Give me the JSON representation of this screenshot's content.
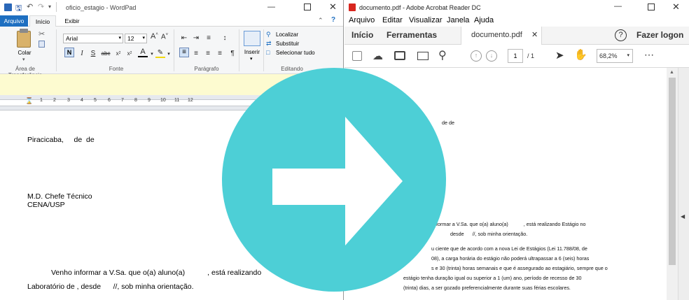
{
  "wordpad": {
    "title": "oficio_estagio - WordPad",
    "tabs": [
      "Arquivo",
      "Início",
      "Exibir"
    ],
    "clipboard": {
      "paste_label": "Colar",
      "group_label": "Área de Transferência"
    },
    "font": {
      "name": "Arial",
      "size": "12",
      "group_label": "Fonte"
    },
    "paragraph": {
      "group_label": "Parágrafo"
    },
    "insert": {
      "label": "Inserir"
    },
    "editing": {
      "find": "Localizar",
      "replace": "Substituir",
      "select_all": "Selecionar tudo",
      "group_label": "Editando"
    },
    "ruler": [
      "1",
      "2",
      "3",
      "4",
      "5",
      "6",
      "7",
      "8",
      "9",
      "10",
      "11",
      "12"
    ],
    "doc": {
      "city_line": "Piracicaba,     de  de",
      "recipient_line1": "M.D. Chefe Técnico",
      "recipient_line2": "CENA/USP",
      "body_line1": "Venho informar a V.Sa. que o(a) aluno(a)           , está realizando",
      "body_line2": "Laboratório de , desde      //, sob minha orientação."
    }
  },
  "acrobat": {
    "title": "documento.pdf - Adobe Acrobat Reader DC",
    "menu": [
      "Arquivo",
      "Editar",
      "Visualizar",
      "Janela",
      "Ajuda"
    ],
    "tabs": {
      "home": "Início",
      "tools": "Ferramentas",
      "doc": "documento.pdf"
    },
    "help": "?",
    "login": "Fazer logon",
    "page_current": "1",
    "page_total": "/ 1",
    "zoom": "68,2%",
    "pdf_text": {
      "line_date": "de  de",
      "p1_a": "formar a V.Sa. que o(a) aluno(a)           , está realizando Estágio no",
      "p1_b": "desde      //, sob minha orientação.",
      "p2_a": "u ciente que de acordo com a nova Lei de Estágios (Lei 11.788/08, de",
      "p2_b": "08), a carga horária do estágio não poderá ultrapassar a 6 (seis) horas",
      "p2_c": "s e 30 (trinta) horas semanais e que é assegurado ao estagiário, sempre que o",
      "p2_d": "estágio tenha duração igual ou superior a 1 (um) ano, período de recesso de 30",
      "p2_e": "(trinta) dias, a ser gozado preferencialmente durante suas férias escolares."
    }
  },
  "colors": {
    "circle": "#4dcfd6",
    "arrow": "#ffffff",
    "wordpad_file_tab": "#1e6fc1"
  }
}
